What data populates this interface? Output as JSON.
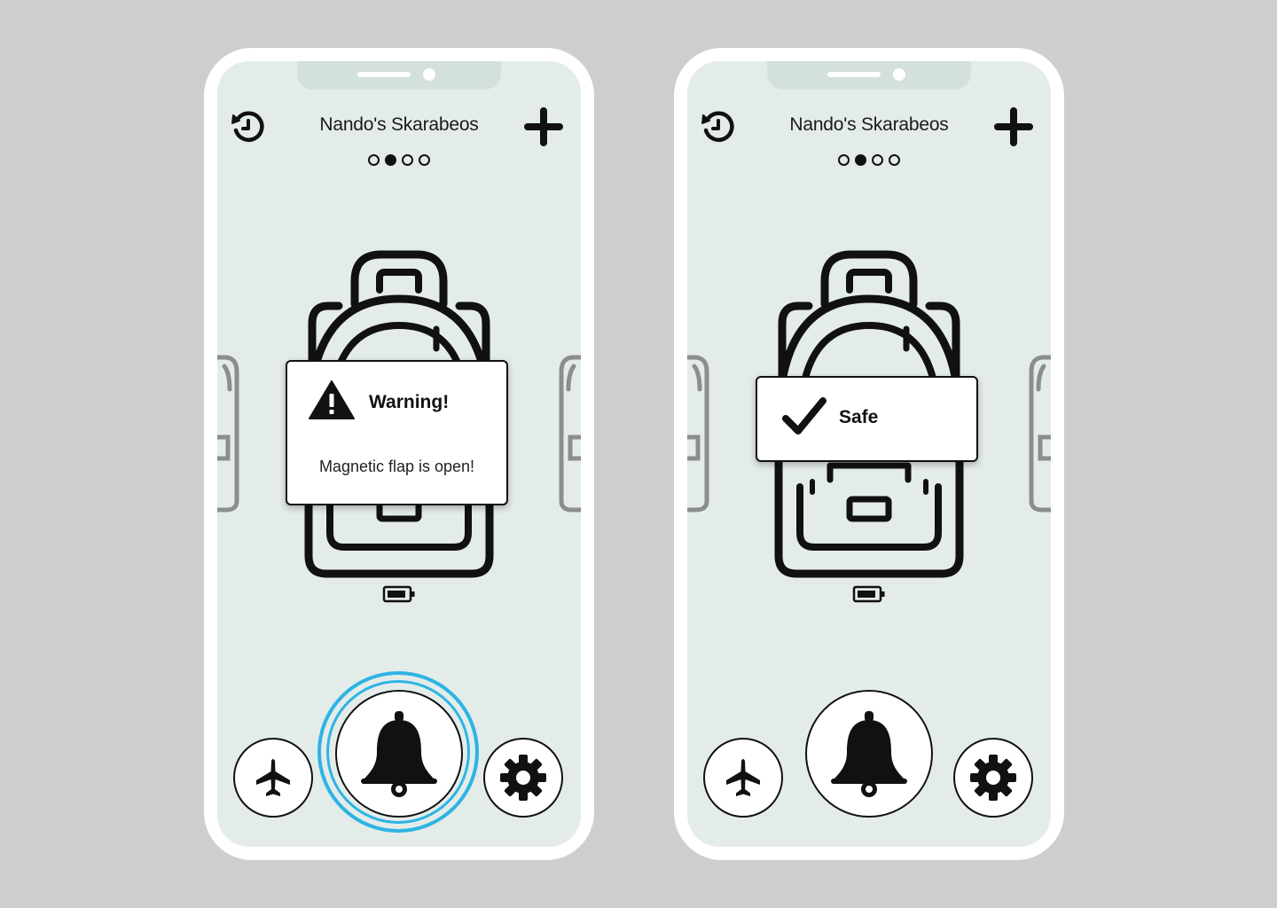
{
  "colors": {
    "background": "#cdcfcc",
    "screen": "#e4ecea",
    "alarm_ring": "#2eb4e4",
    "ink": "#111111"
  },
  "screens": [
    {
      "title": "Nando's Skarabeos",
      "pager": {
        "count": 4,
        "active_index": 1
      },
      "card": {
        "type": "warning",
        "icon": "warning-triangle-icon",
        "title": "Warning!",
        "message": "Magnetic flap is open!"
      },
      "alarm_active": true,
      "icons": [
        "history-icon",
        "plus-icon",
        "backpack-icon",
        "battery-icon",
        "airplane-icon",
        "bell-icon",
        "gear-icon"
      ]
    },
    {
      "title": "Nando's Skarabeos",
      "pager": {
        "count": 4,
        "active_index": 1
      },
      "card": {
        "type": "safe",
        "icon": "checkmark-icon",
        "title": "Safe"
      },
      "alarm_active": false,
      "icons": [
        "history-icon",
        "plus-icon",
        "backpack-icon",
        "battery-icon",
        "airplane-icon",
        "bell-icon",
        "gear-icon"
      ]
    }
  ]
}
